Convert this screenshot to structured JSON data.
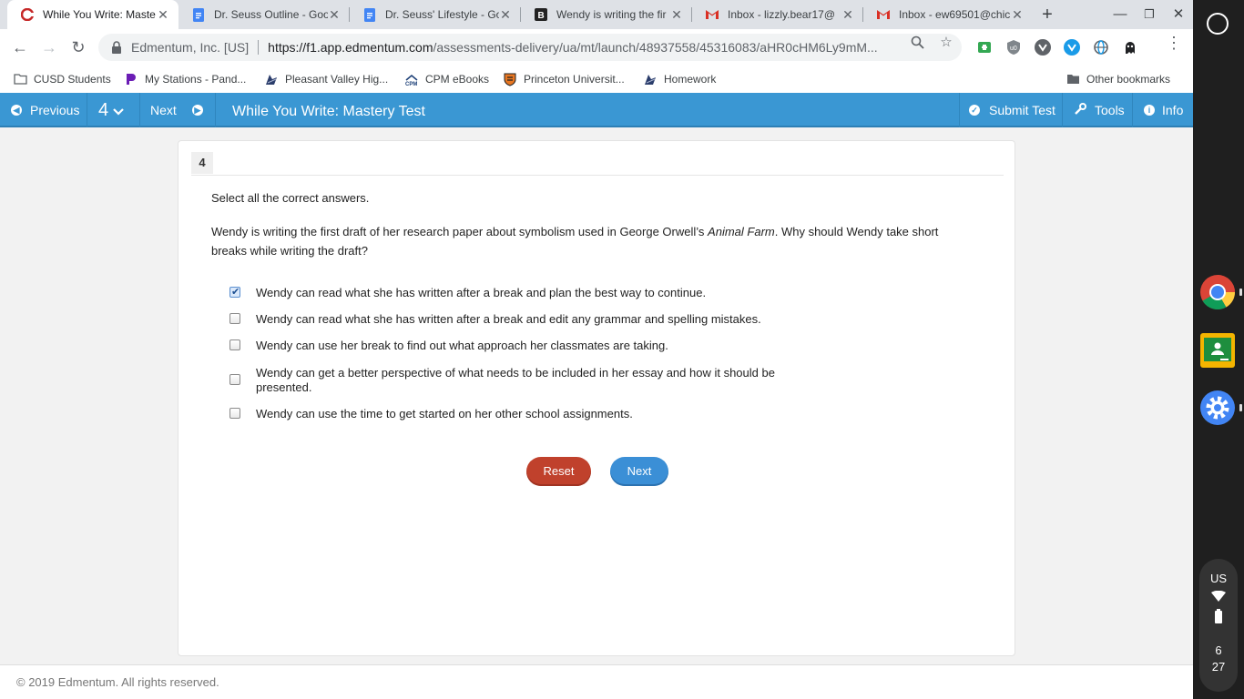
{
  "tabs": [
    {
      "title": "While You Write: Maste",
      "icon": "edmentum-favicon",
      "active": true
    },
    {
      "title": "Dr. Seuss Outline - Goo",
      "icon": "google-docs-icon"
    },
    {
      "title": "Dr. Seuss' Lifestyle - Go",
      "icon": "google-docs-icon"
    },
    {
      "title": "Wendy is writing the fir",
      "icon": "brainly-icon"
    },
    {
      "title": "Inbox - lizzly.bear17@",
      "icon": "gmail-icon"
    },
    {
      "title": "Inbox - ew69501@chic",
      "icon": "gmail-icon"
    }
  ],
  "omnibox": {
    "site_name": "Edmentum, Inc. [US]",
    "url_host": "https://f1.app.edmentum.com",
    "url_path": "/assessments-delivery/ua/mt/launch/48937558/45316083/aHR0cHM6Ly9mM..."
  },
  "bookmarks": [
    {
      "label": "CUSD Students",
      "icon": "folder-icon"
    },
    {
      "label": "My Stations - Pand...",
      "icon": "pandora-icon"
    },
    {
      "label": "Pleasant Valley Hig...",
      "icon": "viking-icon"
    },
    {
      "label": "CPM eBooks",
      "icon": "cpm-icon"
    },
    {
      "label": "Princeton Universit...",
      "icon": "princeton-shield-icon"
    },
    {
      "label": "Homework",
      "icon": "viking-icon"
    },
    {
      "label": "Other bookmarks",
      "icon": "folder-icon"
    }
  ],
  "header": {
    "previous_label": "Previous",
    "question_number": "4",
    "next_label": "Next",
    "test_title": "While You Write: Mastery Test",
    "submit_label": "Submit Test",
    "tools_label": "Tools",
    "info_label": "Info"
  },
  "question": {
    "number": "4",
    "instruction": "Select all the correct answers.",
    "stem_before": "Wendy is writing the first draft of her research paper about symbolism used in George Orwell’s ",
    "stem_title": "Animal Farm",
    "stem_after": ". Why should Wendy take short breaks while writing the draft?",
    "options": [
      {
        "text": "Wendy can read what she has written after a break and plan the best way to continue.",
        "checked": true
      },
      {
        "text": "Wendy can read what she has written after a break and edit any grammar and spelling mistakes.",
        "checked": false
      },
      {
        "text": "Wendy can use her break to find out what approach her classmates are taking.",
        "checked": false
      },
      {
        "text": "Wendy can get a better perspective of what needs to be included in her essay and how it should be presented.",
        "checked": false
      },
      {
        "text": "Wendy can use the time to get started on her other school assignments.",
        "checked": false
      }
    ],
    "reset_label": "Reset",
    "next_label": "Next"
  },
  "footer": {
    "copyright": "© 2019 Edmentum. All rights reserved."
  },
  "shelf": {
    "keyboard_layout": "US",
    "time_hour": "6",
    "time_minute": "27"
  },
  "colors": {
    "header_blue": "#3a97d3",
    "reset_red": "#c0412c",
    "next_blue": "#3b8fd6"
  }
}
